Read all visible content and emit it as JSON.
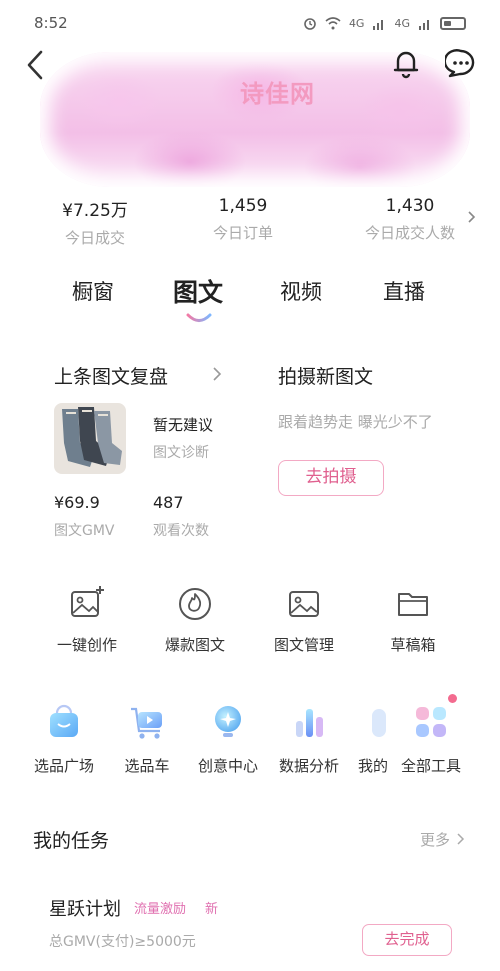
{
  "status_bar": {
    "time": "8:52",
    "signal_label_1": "4G",
    "signal_label_2": "4G"
  },
  "banner": {
    "logo_text": "诗佳网"
  },
  "stats": [
    {
      "value": "¥7.25万",
      "label": "今日成交"
    },
    {
      "value": "1,459",
      "label": "今日订单"
    },
    {
      "value": "1,430",
      "label": "今日成交人数"
    }
  ],
  "tabs": [
    {
      "label": "橱窗",
      "active": false
    },
    {
      "label": "图文",
      "active": true
    },
    {
      "label": "视频",
      "active": false
    },
    {
      "label": "直播",
      "active": false
    }
  ],
  "last_post_review": {
    "title": "上条图文复盘",
    "suggestion": "暂无建议",
    "suggestion_sub": "图文诊断",
    "gmv_value": "¥69.9",
    "gmv_label": "图文GMV",
    "views_value": "487",
    "views_label": "观看次数"
  },
  "new_post": {
    "title": "拍摄新图文",
    "subtitle": "跟着趋势走 曝光少不了",
    "button": "去拍摄"
  },
  "tools": [
    {
      "label": "一键创作",
      "icon": "image-plus-icon"
    },
    {
      "label": "爆款图文",
      "icon": "fire-icon"
    },
    {
      "label": "图文管理",
      "icon": "image-icon"
    },
    {
      "label": "草稿箱",
      "icon": "folder-icon"
    }
  ],
  "features": [
    {
      "label": "选品广场",
      "icon": "shopping-bag-icon"
    },
    {
      "label": "选品车",
      "icon": "cart-icon"
    },
    {
      "label": "创意中心",
      "icon": "bulb-icon"
    },
    {
      "label": "数据分析",
      "icon": "bar-chart-icon"
    },
    {
      "label": "我的",
      "icon": "partial-icon"
    },
    {
      "label": "全部工具",
      "icon": "grid-icon"
    }
  ],
  "tasks": {
    "title": "我的任务",
    "more": "更多",
    "item": {
      "name": "星跃计划",
      "tag1": "流量激励",
      "tag2": "新",
      "desc": "总GMV(支付)≥5000元",
      "button": "去完成"
    }
  },
  "colors": {
    "accent": "#e0608f",
    "muted": "#aaaaaa"
  }
}
